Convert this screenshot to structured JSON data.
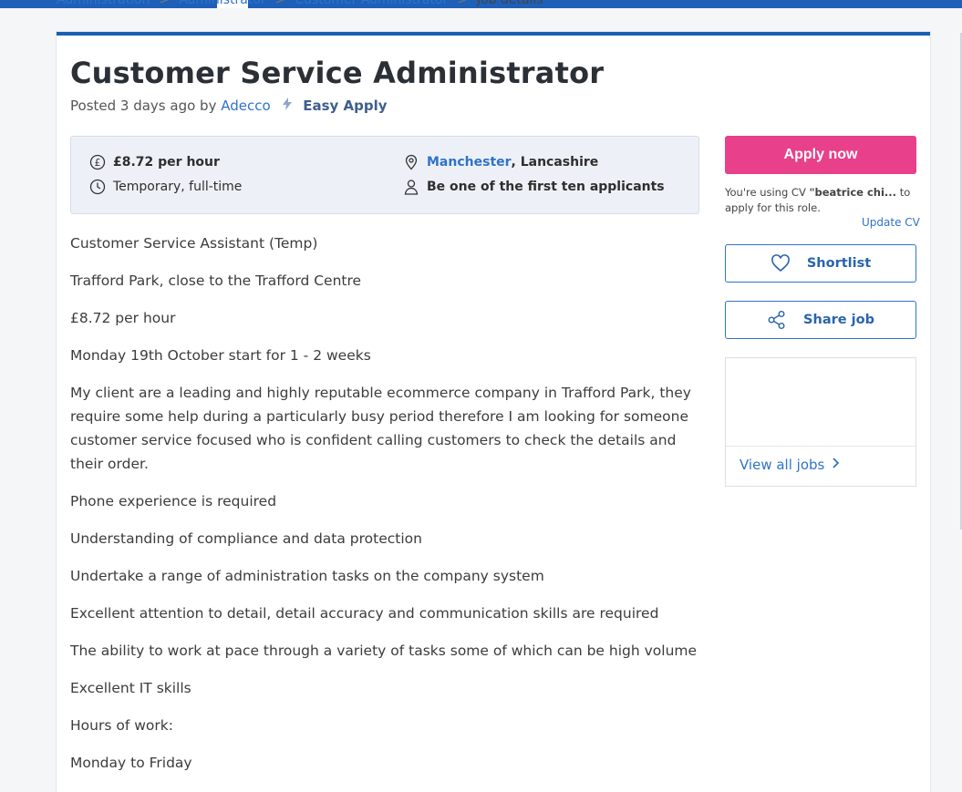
{
  "breadcrumb": {
    "items": [
      "Administration",
      "Administrator",
      "Customer Administrator",
      "Job details"
    ],
    "separator": ">"
  },
  "job": {
    "title": "Customer Service Administrator",
    "posted_prefix": "Posted 3 days ago by",
    "company": "Adecco",
    "easy_apply": "Easy Apply",
    "salary": "£8.72 per hour",
    "type": "Temporary, full-time",
    "location_city": "Manchester",
    "location_region": ", Lancashire",
    "applicants": "Be one of the first ten applicants"
  },
  "description": [
    "Customer Service Assistant (Temp)",
    "Trafford Park, close to the Trafford Centre",
    "£8.72 per hour",
    "Monday 19th October start for 1 - 2 weeks",
    "My client are a leading and highly reputable ecommerce company in Trafford Park, they require some help during a particularly busy period therefore I am looking for someone customer service focused who is confident calling customers to check the details and their order.",
    "Phone experience is required",
    "Understanding of compliance and data protection",
    "Undertake a range of administration tasks on the company system",
    "Excellent attention to detail, detail accuracy and communication skills are required",
    "The ability to work at pace through a variety of tasks some of which can be high volume",
    "Excellent IT skills",
    "Hours of work:",
    "Monday to Friday"
  ],
  "sidebar": {
    "apply_label": "Apply now",
    "cv_prefix": "You're using CV ",
    "cv_name": "\"beatrice chi...",
    "cv_suffix": " to apply for this role.",
    "update_cv": "Update CV",
    "shortlist_label": "Shortlist",
    "share_label": "Share job",
    "view_all_label": "View all jobs"
  },
  "colors": {
    "brand_blue": "#1a5fb4",
    "link_blue": "#2f73c9",
    "apply_pink": "#e8408a"
  },
  "icons": [
    "pound-icon",
    "clock-icon",
    "location-pin-icon",
    "person-icon",
    "lightning-icon",
    "heart-icon",
    "share-icon",
    "chevron-right-icon"
  ]
}
